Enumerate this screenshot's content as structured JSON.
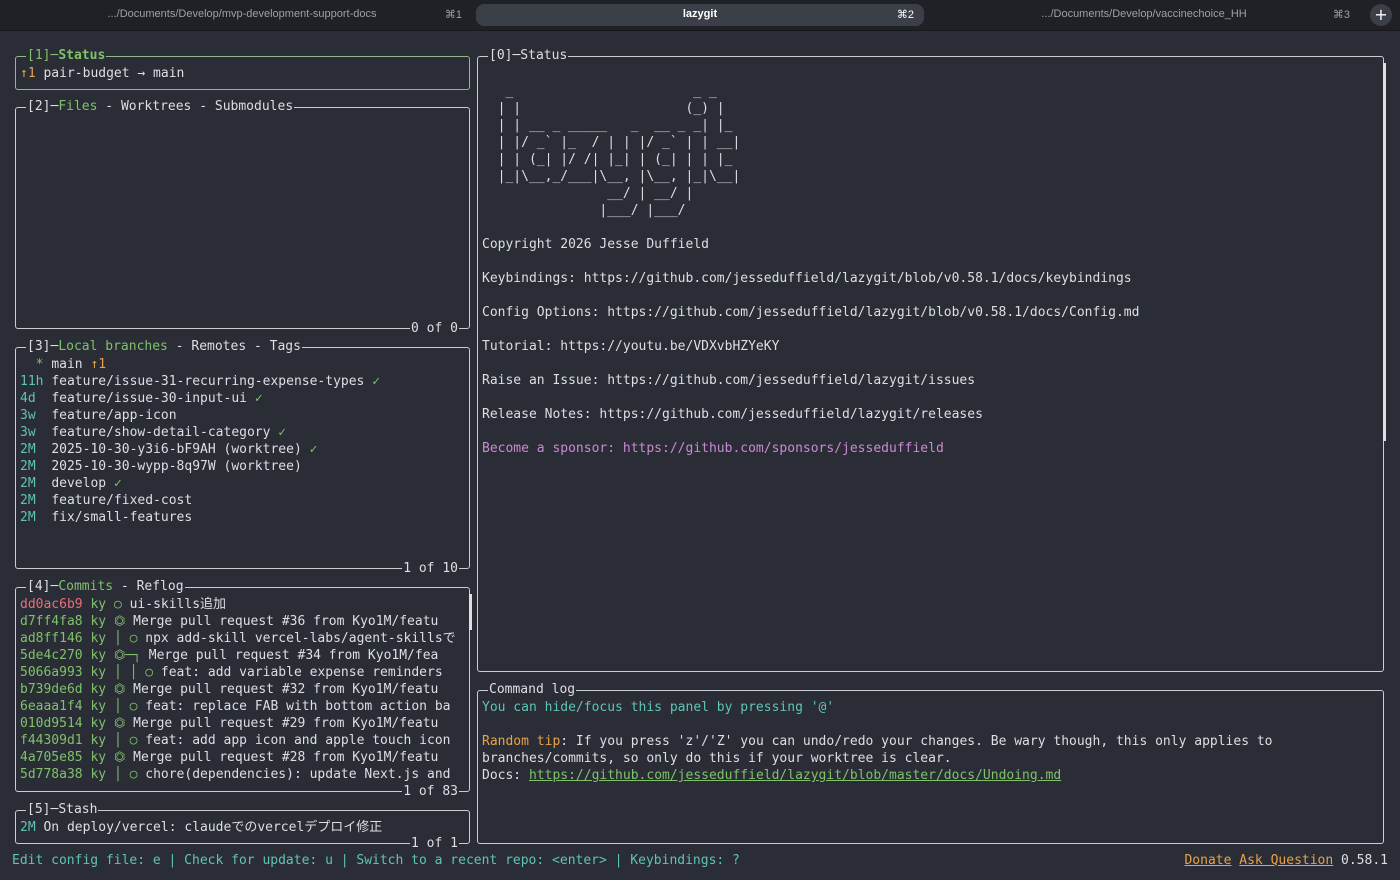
{
  "tabs": [
    {
      "title": ".../Documents/Develop/mvp-development-support-docs",
      "key": "⌘1"
    },
    {
      "title": "lazygit",
      "key": "⌘2"
    },
    {
      "title": ".../Documents/Develop/vaccinechoice_HH",
      "key": "⌘3"
    }
  ],
  "new_tab_label": "+",
  "status_panel": {
    "title_num": "[1]",
    "title": "Status",
    "ahead": "↑1",
    "text": "pair-budget → main"
  },
  "files_panel": {
    "title_num": "[2]",
    "tab_active": "Files",
    "sep": " - ",
    "tab2": "Worktrees",
    "tab3": "Submodules",
    "footer": "0 of 0"
  },
  "branches_panel": {
    "title_num": "[3]",
    "tab_active": "Local branches",
    "sep": " - ",
    "tab2": "Remotes",
    "tab3": "Tags",
    "footer": "1 of 10",
    "items": [
      {
        "age": "  *",
        "name": "main",
        "suffix": "↑1",
        "suffix_kind": "ahead"
      },
      {
        "age": "11h",
        "name": "feature/issue-31-recurring-expense-types",
        "suffix": "✓",
        "suffix_kind": "tick"
      },
      {
        "age": "4d ",
        "name": "feature/issue-30-input-ui",
        "suffix": "✓",
        "suffix_kind": "tick"
      },
      {
        "age": "3w ",
        "name": "feature/app-icon",
        "suffix": "",
        "suffix_kind": ""
      },
      {
        "age": "3w ",
        "name": "feature/show-detail-category",
        "suffix": "✓",
        "suffix_kind": "tick"
      },
      {
        "age": "2M ",
        "name": "2025-10-30-y3i6-bF9AH (worktree)",
        "suffix": "✓",
        "suffix_kind": "tick"
      },
      {
        "age": "2M ",
        "name": "2025-10-30-wypp-8q97W (worktree)",
        "suffix": "",
        "suffix_kind": ""
      },
      {
        "age": "2M ",
        "name": "develop",
        "suffix": "✓",
        "suffix_kind": "tick"
      },
      {
        "age": "2M ",
        "name": "feature/fixed-cost",
        "suffix": "",
        "suffix_kind": ""
      },
      {
        "age": "2M ",
        "name": "fix/small-features",
        "suffix": "",
        "suffix_kind": ""
      }
    ]
  },
  "commits_panel": {
    "title_num": "[4]",
    "tab_active": "Commits",
    "sep": " - ",
    "tab2": "Reflog",
    "footer": "1 of 83",
    "items": [
      {
        "hash": "dd0ac6b9",
        "author": "ky",
        "graph": "○",
        "msg": "ui-skills追加",
        "hash_kind": "red"
      },
      {
        "hash": "d7ff4fa8",
        "author": "ky",
        "graph": "⏣",
        "msg": "Merge pull request #36 from Kyo1M/featu",
        "hash_kind": "green"
      },
      {
        "hash": "ad8ff146",
        "author": "ky",
        "graph": "│ ○",
        "msg": "npx add-skill vercel-labs/agent-skillsで",
        "hash_kind": "green"
      },
      {
        "hash": "5de4c270",
        "author": "ky",
        "graph": "⏣─┐",
        "msg": "Merge pull request #34 from Kyo1M/fea",
        "hash_kind": "green"
      },
      {
        "hash": "5066a993",
        "author": "ky",
        "graph": "│ │ ○",
        "msg": "feat: add variable expense reminders",
        "hash_kind": "green"
      },
      {
        "hash": "b739de6d",
        "author": "ky",
        "graph": "⏣",
        "msg": "Merge pull request #32 from Kyo1M/featu",
        "hash_kind": "green"
      },
      {
        "hash": "6eaaa1f4",
        "author": "ky",
        "graph": "│ ○",
        "msg": "feat: replace FAB with bottom action ba",
        "hash_kind": "green"
      },
      {
        "hash": "010d9514",
        "author": "ky",
        "graph": "⏣",
        "msg": "Merge pull request #29 from Kyo1M/featu",
        "hash_kind": "green"
      },
      {
        "hash": "f44309d1",
        "author": "ky",
        "graph": "│ ○",
        "msg": "feat: add app icon and apple touch icon",
        "hash_kind": "green"
      },
      {
        "hash": "4a705e85",
        "author": "ky",
        "graph": "⏣",
        "msg": "Merge pull request #28 from Kyo1M/featu",
        "hash_kind": "green"
      },
      {
        "hash": "5d778a38",
        "author": "ky",
        "graph": "│ ○",
        "msg": "chore(dependencies): update Next.js and",
        "hash_kind": "green"
      }
    ]
  },
  "stash_panel": {
    "title_num": "[5]",
    "title": "Stash",
    "footer": "1 of 1",
    "items": [
      {
        "age": "2M",
        "msg": "On deploy/vercel: claudeでのvercelデプロイ修正"
      }
    ]
  },
  "main_panel": {
    "title": "[0]─Status",
    "ascii": [
      "   _                       _ _",
      "  | |                     (_) |",
      "  | | __ _ _____   _  __ _ _| |_",
      "  | |/ _` |_  / | | |/ _` | | __|",
      "  | | (_| |/ /| |_| | (_| | | |_",
      "  |_|\\__,_/___|\\__, |\\__, |_|\\__|",
      "                __/ | __/ |",
      "               |___/ |___/"
    ],
    "copyright": "Copyright 2026 Jesse Duffield",
    "lines": [
      "Keybindings: https://github.com/jesseduffield/lazygit/blob/v0.58.1/docs/keybindings",
      "Config Options: https://github.com/jesseduffield/lazygit/blob/v0.58.1/docs/Config.md",
      "Tutorial: https://youtu.be/VDXvbHZYeKY",
      "Raise an Issue: https://github.com/jesseduffield/lazygit/issues",
      "Release Notes: https://github.com/jesseduffield/lazygit/releases"
    ],
    "sponsor": "Become a sponsor: https://github.com/sponsors/jesseduffield"
  },
  "command_log": {
    "title": "Command log",
    "hint": "You can hide/focus this panel by pressing '@'",
    "tip_label": "Random tip",
    "tip_text": ": If you press 'z'/'Z' you can undo/redo your changes. Be wary though, this only applies to",
    "tip_text2": "branches/commits, so only do this if your worktree is clear.",
    "docs_label": "Docs: ",
    "docs_link": "https://github.com/jesseduffield/lazygit/blob/master/docs/Undoing.md"
  },
  "status_bar": {
    "text": "Edit config file: e | Check for update: u | Switch to a recent repo: <enter> | Keybindings: ?",
    "donate": "Donate",
    "ask": "Ask Question",
    "version": "0.58.1"
  },
  "colors": {
    "active_border": "#8fb98a",
    "green": "#7fc26b",
    "red": "#e86f7a",
    "cyan": "#5ec4b6",
    "orange": "#e8a24a",
    "magenta": "#c98ad4"
  }
}
